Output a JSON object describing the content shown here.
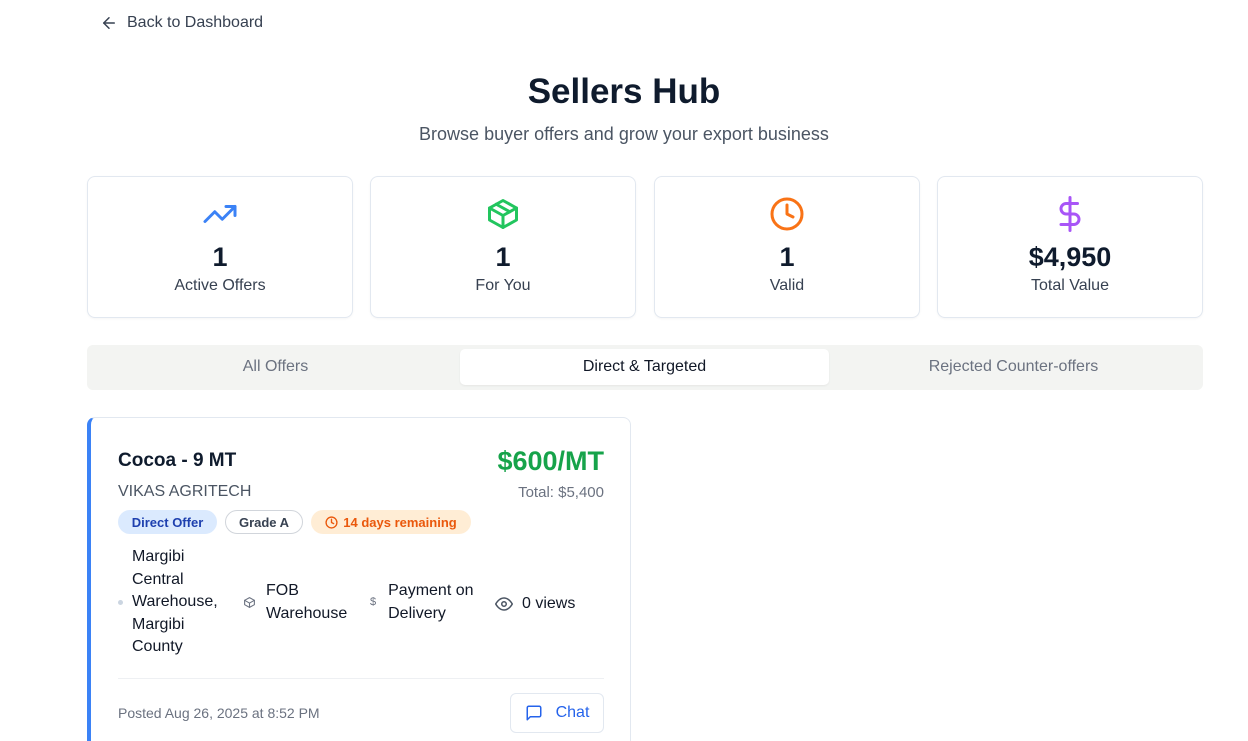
{
  "nav": {
    "back_label": "Back to Dashboard"
  },
  "header": {
    "title": "Sellers Hub",
    "subtitle": "Browse buyer offers and grow your export business"
  },
  "stats": [
    {
      "icon": "trending-up-icon",
      "value": "1",
      "label": "Active Offers",
      "color": "#3b82f6"
    },
    {
      "icon": "package-icon",
      "value": "1",
      "label": "For You",
      "color": "#22c55e"
    },
    {
      "icon": "clock-icon",
      "value": "1",
      "label": "Valid",
      "color": "#f97316"
    },
    {
      "icon": "dollar-icon",
      "value": "$4,950",
      "label": "Total Value",
      "color": "#a855f7"
    }
  ],
  "tabs": [
    {
      "label": "All Offers",
      "active": false
    },
    {
      "label": "Direct & Targeted",
      "active": true
    },
    {
      "label": "Rejected Counter-offers",
      "active": false
    }
  ],
  "offer": {
    "title": "Cocoa - 9 MT",
    "seller": "VIKAS AGRITECH",
    "price": "$600/MT",
    "total": "Total: $5,400",
    "badges": {
      "type": "Direct Offer",
      "grade": "Grade A",
      "remaining": "14 days remaining"
    },
    "location": "Margibi Central Warehouse, Margibi County",
    "incoterm": "FOB Warehouse",
    "payment": "Payment on Delivery",
    "views": "0 views",
    "posted": "Posted Aug 26, 2025 at 8:52 PM",
    "chat_label": "Chat",
    "accent_color": "#3b82f6"
  }
}
